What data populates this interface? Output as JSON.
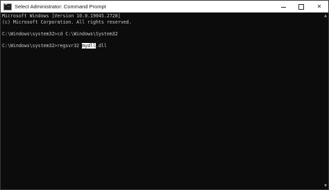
{
  "window": {
    "title": "Select Administrator: Command Prompt",
    "minimize_icon": "minimize-icon",
    "maximize_icon": "maximize-icon",
    "close_label": "✕"
  },
  "console": {
    "line1": "Microsoft Windows [Version 10.0.19045.2728]",
    "line2": "(c) Microsoft Corporation. All rights reserved.",
    "line3": "",
    "line4": "C:\\Windows\\system32>cd C:\\Windows\\System32",
    "line5": "",
    "line6_prefix": "C:\\Windows\\system32>regsvr32 ",
    "line6_selected": "mydll",
    "line6_suffix": ".dll"
  },
  "colors": {
    "background": "#0c0c0c",
    "text": "#cccccc",
    "titlebar": "#ffffff",
    "selection": "#ffffff"
  }
}
